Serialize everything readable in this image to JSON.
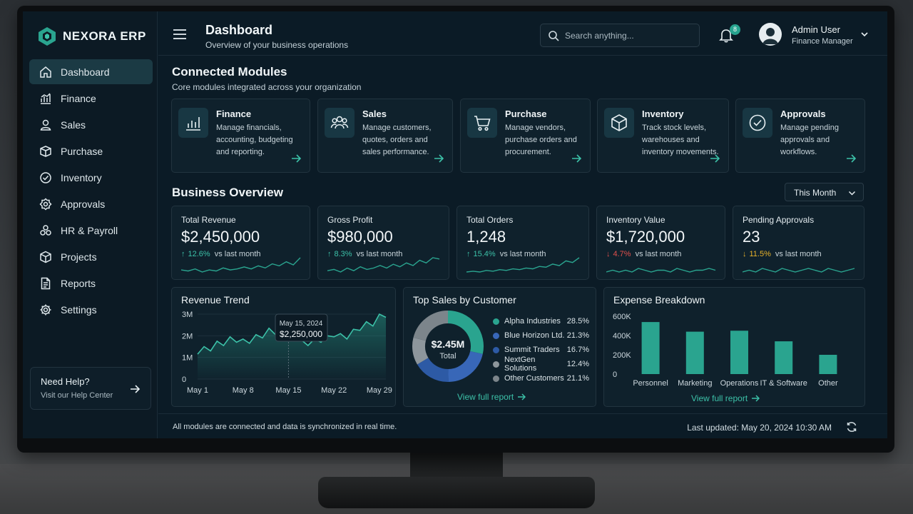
{
  "app": {
    "name": "NEXORA ERP"
  },
  "sidebar": {
    "items": [
      {
        "label": "Dashboard",
        "icon": "home-icon"
      },
      {
        "label": "Finance",
        "icon": "finance-chart-icon"
      },
      {
        "label": "Sales",
        "icon": "user-icon"
      },
      {
        "label": "Purchase",
        "icon": "box-icon"
      },
      {
        "label": "Inventory",
        "icon": "check-circle-icon"
      },
      {
        "label": "Approvals",
        "icon": "gear-badge-icon"
      },
      {
        "label": "HR & Payroll",
        "icon": "team-icon"
      },
      {
        "label": "Projects",
        "icon": "cube-icon"
      },
      {
        "label": "Reports",
        "icon": "document-icon"
      },
      {
        "label": "Settings",
        "icon": "gear-icon"
      }
    ],
    "active": "Dashboard",
    "help": {
      "title": "Need Help?",
      "subtitle": "Visit our Help Center"
    }
  },
  "header": {
    "title": "Dashboard",
    "subtitle": "Overview of your business operations",
    "search_placeholder": "Search anything...",
    "notification_count": "8",
    "user_name": "Admin User",
    "user_role": "Finance Manager"
  },
  "modules": {
    "title": "Connected Modules",
    "subtitle": "Core modules integrated across your organization",
    "items": [
      {
        "title": "Finance",
        "desc": "Manage financials, accounting, budgeting and reporting.",
        "icon": "bar-chart-icon"
      },
      {
        "title": "Sales",
        "desc": "Manage customers, quotes, orders and sales performance.",
        "icon": "people-icon"
      },
      {
        "title": "Purchase",
        "desc": "Manage vendors, purchase orders and procurement.",
        "icon": "cart-icon"
      },
      {
        "title": "Inventory",
        "desc": "Track stock levels, warehouses and inventory movements.",
        "icon": "cube-icon"
      },
      {
        "title": "Approvals",
        "desc": "Manage pending approvals and workflows.",
        "icon": "check-circle-icon"
      }
    ]
  },
  "overview": {
    "title": "Business Overview",
    "period": "This Month",
    "kpis": [
      {
        "label": "Total Revenue",
        "value": "$2,450,000",
        "delta": "12.6%",
        "direction": "up",
        "color": "#3cc1a8",
        "vs": "vs last month"
      },
      {
        "label": "Gross Profit",
        "value": "$980,000",
        "delta": "8.3%",
        "direction": "up",
        "color": "#3cc1a8",
        "vs": "vs last month"
      },
      {
        "label": "Total Orders",
        "value": "1,248",
        "delta": "15.4%",
        "direction": "up",
        "color": "#3cc1a8",
        "vs": "vs last month"
      },
      {
        "label": "Inventory Value",
        "value": "$1,720,000",
        "delta": "4.7%",
        "direction": "down",
        "color": "#e2504c",
        "vs": "vs last month"
      },
      {
        "label": "Pending Approvals",
        "value": "23",
        "delta": "11.5%",
        "direction": "down",
        "color": "#e9b32a",
        "vs": "vs last month"
      }
    ]
  },
  "panels": {
    "revenue_trend": {
      "title": "Revenue Trend",
      "tooltip_date": "May 15, 2024",
      "tooltip_value": "$2,250,000"
    },
    "top_sales": {
      "title": "Top Sales by Customer",
      "center_value": "$2.45M",
      "center_label": "Total",
      "link": "View full report"
    },
    "expense": {
      "title": "Expense Breakdown",
      "link": "View full report"
    }
  },
  "footer": {
    "sync_text": "All modules are connected and data is synchronized in real time.",
    "last_updated": "Last updated: May 20, 2024 10:30 AM"
  },
  "colors": {
    "accent": "#2aa48f",
    "accent_light": "#3cc1a8",
    "down": "#e2504c",
    "warn": "#e9b32a"
  },
  "chart_data": [
    {
      "type": "area",
      "title": "Revenue Trend",
      "x_ticks": [
        "May 1",
        "May 8",
        "May 15",
        "May 22",
        "May 29"
      ],
      "y_ticks": [
        "3M",
        "2M",
        "1M",
        "0"
      ],
      "ylim": [
        0,
        3000000
      ],
      "x": [
        1,
        2,
        3,
        4,
        5,
        6,
        7,
        8,
        9,
        10,
        11,
        12,
        13,
        14,
        15,
        16,
        17,
        18,
        19,
        20,
        21,
        22,
        23,
        24,
        25,
        26,
        27,
        28,
        29,
        30
      ],
      "y": [
        1150000,
        1500000,
        1300000,
        1750000,
        1550000,
        1950000,
        1700000,
        1850000,
        1650000,
        2050000,
        1900000,
        2350000,
        2050000,
        1950000,
        2250000,
        2000000,
        1800000,
        1550000,
        1850000,
        1700000,
        2000000,
        1950000,
        2100000,
        1850000,
        2300000,
        2250000,
        2650000,
        2450000,
        3000000,
        2850000
      ]
    },
    {
      "type": "pie",
      "title": "Top Sales by Customer",
      "labels": [
        "Alpha Industries",
        "Blue Horizon Ltd.",
        "Summit Traders",
        "NextGen Solutions",
        "Other Customers"
      ],
      "values": [
        28.5,
        21.3,
        16.7,
        12.4,
        21.1
      ],
      "display": [
        "28.5%",
        "21.3%",
        "16.7%",
        "12.4%",
        "21.1%"
      ],
      "colors": [
        "#2aa48f",
        "#3867b8",
        "#2d5aa5",
        "#8d969c",
        "#7c858b"
      ]
    },
    {
      "type": "bar",
      "title": "Expense Breakdown",
      "categories": [
        "Personnel",
        "Marketing",
        "Operations",
        "IT & Software",
        "Other"
      ],
      "values": [
        540000,
        440000,
        450000,
        340000,
        200000
      ],
      "y_ticks": [
        "600K",
        "400K",
        "200K",
        "0"
      ],
      "ylim": [
        0,
        600000
      ],
      "color": "#2aa48f"
    }
  ]
}
